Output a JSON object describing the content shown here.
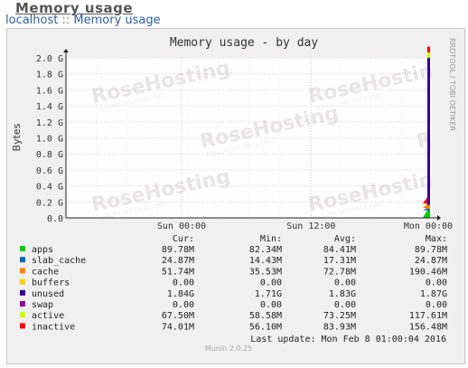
{
  "page": {
    "heading": "Memory usage",
    "breadcrumb_host": "localhost",
    "breadcrumb_sep": "::",
    "breadcrumb_page": "Memory usage"
  },
  "watermark": {
    "text": "RoseHosting",
    "subtext": "QUALITY VPS SINCE 2001"
  },
  "chart_data": {
    "type": "area",
    "title": "Memory usage - by day",
    "ylabel": "Bytes",
    "xlabel": "",
    "ylim": [
      0,
      2.0
    ],
    "y_unit": "G",
    "y_ticks": [
      "0.0",
      "0.2 G",
      "0.4 G",
      "0.6 G",
      "0.8 G",
      "1.0 G",
      "1.2 G",
      "1.4 G",
      "1.6 G",
      "1.8 G",
      "2.0 G"
    ],
    "x_ticks": [
      "Sun 00:00",
      "Sun 12:00",
      "Mon 00:00"
    ],
    "side_label": "RRDTOOL / TOBI OETIKER",
    "columns": [
      "Cur:",
      "Min:",
      "Avg:",
      "Max:"
    ],
    "series": [
      {
        "name": "apps",
        "color": "#00cc00",
        "cur": "89.78M",
        "min": "82.34M",
        "avg": "84.41M",
        "max": "89.78M"
      },
      {
        "name": "slab_cache",
        "color": "#0066b3",
        "cur": "24.87M",
        "min": "14.43M",
        "avg": "17.31M",
        "max": "24.87M"
      },
      {
        "name": "cache",
        "color": "#ff8000",
        "cur": "51.74M",
        "min": "35.53M",
        "avg": "72.78M",
        "max": "190.46M"
      },
      {
        "name": "buffers",
        "color": "#ffcc00",
        "cur": "0.00",
        "min": "0.00",
        "avg": "0.00",
        "max": "0.00"
      },
      {
        "name": "unused",
        "color": "#330099",
        "cur": "1.84G",
        "min": "1.71G",
        "avg": "1.83G",
        "max": "1.87G"
      },
      {
        "name": "swap",
        "color": "#990099",
        "cur": "0.00",
        "min": "0.00",
        "avg": "0.00",
        "max": "0.00"
      },
      {
        "name": "active",
        "color": "#ccff00",
        "cur": "67.50M",
        "min": "58.58M",
        "avg": "73.25M",
        "max": "117.61M"
      },
      {
        "name": "inactive",
        "color": "#ff0000",
        "cur": "74.01M",
        "min": "56.10M",
        "avg": "83.93M",
        "max": "156.48M"
      }
    ],
    "last_update": "Last update:  Mon Feb  8 01:00:04 2016",
    "footer": "Munin 2.0.25",
    "grid": true
  }
}
